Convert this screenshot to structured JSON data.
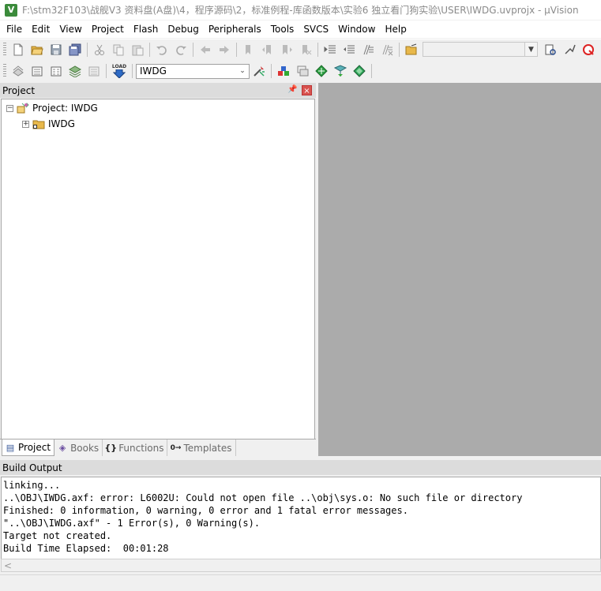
{
  "window": {
    "title": "F:\\stm32F103\\战舰V3 资料盘(A盘)\\4，程序源码\\2，标准例程-库函数版本\\实验6 独立看门狗实验\\USER\\IWDG.uvprojx - µVision",
    "app_icon_letter": "V"
  },
  "menu": [
    "File",
    "Edit",
    "View",
    "Project",
    "Flash",
    "Debug",
    "Peripherals",
    "Tools",
    "SVCS",
    "Window",
    "Help"
  ],
  "toolbar1": {
    "icons": [
      "new-file-icon",
      "open-folder-icon",
      "save-icon",
      "save-all-icon",
      "cut-icon",
      "copy-icon",
      "paste-icon",
      "undo-icon",
      "redo-icon",
      "nav-back-icon",
      "nav-forward-icon",
      "bookmark-icon",
      "bookmark-prev-icon",
      "bookmark-next-icon",
      "bookmark-clear-icon",
      "indent-icon",
      "unindent-icon",
      "comment-icon",
      "uncomment-icon",
      "find-in-files-icon"
    ],
    "find_combo_value": "",
    "right_icons": [
      "incremental-find-icon",
      "debug-session-icon",
      "search-icon"
    ]
  },
  "toolbar2": {
    "icons_left": [
      "translate-icon",
      "build-icon",
      "rebuild-icon",
      "batch-build-icon",
      "stop-build-icon",
      "download-load-icon"
    ],
    "load_label": "LOAD",
    "target_select": "IWDG",
    "icons_right": [
      "target-options-icon",
      "manage-project-items-icon",
      "pack-installer-icon",
      "select-packs-icon",
      "manage-rte-icon",
      "green-diamond-icon"
    ]
  },
  "project_panel": {
    "title": "Project",
    "tree": {
      "root_label": "Project: IWDG",
      "root_expander": "−",
      "child_label": "IWDG",
      "child_expander": "+"
    },
    "tabs": [
      {
        "label": "Project",
        "icon": "project-tab-icon",
        "glyph": "▤"
      },
      {
        "label": "Books",
        "icon": "books-tab-icon",
        "glyph": "◈"
      },
      {
        "label": "Functions",
        "icon": "functions-tab-icon",
        "glyph": "{}"
      },
      {
        "label": "Templates",
        "icon": "templates-tab-icon",
        "glyph": "0→"
      }
    ]
  },
  "build_output": {
    "title": "Build Output",
    "lines": [
      "linking...",
      "..\\OBJ\\IWDG.axf: error: L6002U: Could not open file ..\\obj\\sys.o: No such file or directory",
      "Finished: 0 information, 0 warning, 0 error and 1 fatal error messages.",
      "\"..\\OBJ\\IWDG.axf\" - 1 Error(s), 0 Warning(s).",
      "Target not created.",
      "Build Time Elapsed:  00:01:28"
    ],
    "scroll_left_glyph": "<"
  }
}
